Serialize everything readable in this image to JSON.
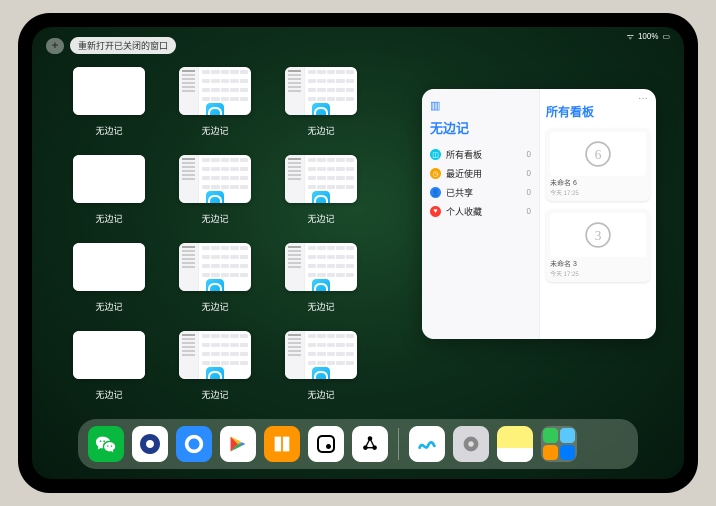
{
  "status": {
    "battery": "100%"
  },
  "topbar": {
    "plus": "+",
    "reopen_label": "重新打开已关闭的窗口"
  },
  "tile_label": "无边记",
  "tiles": [
    {
      "style": "blank"
    },
    {
      "style": "cal"
    },
    {
      "style": "cal"
    },
    {
      "style": "blank"
    },
    {
      "style": "cal"
    },
    {
      "style": "cal"
    },
    {
      "style": "blank"
    },
    {
      "style": "cal"
    },
    {
      "style": "cal"
    },
    {
      "style": "blank"
    },
    {
      "style": "cal"
    },
    {
      "style": "cal"
    }
  ],
  "popup": {
    "left_title": "无边记",
    "right_title": "所有看板",
    "more": "···",
    "categories": [
      {
        "label": "所有看板",
        "count": 0,
        "color": "#0ac8e8",
        "icon": "grid"
      },
      {
        "label": "最近使用",
        "count": 0,
        "color": "#f7a500",
        "icon": "clock"
      },
      {
        "label": "已共享",
        "count": 0,
        "color": "#2a82ff",
        "icon": "person"
      },
      {
        "label": "个人收藏",
        "count": 0,
        "color": "#ff3b30",
        "icon": "heart"
      }
    ],
    "boards": [
      {
        "name": "未命名 6",
        "time": "今天 17:25",
        "glyph": "6"
      },
      {
        "name": "未命名 3",
        "time": "今天 17:25",
        "glyph": "3"
      }
    ]
  },
  "dock": {
    "apps": [
      {
        "name": "wechat",
        "bg": "#09b83e"
      },
      {
        "name": "app-blue-o",
        "bg": "#ffffff"
      },
      {
        "name": "qq-browser",
        "bg": "#2a8cff"
      },
      {
        "name": "play",
        "bg": "#ffffff"
      },
      {
        "name": "books",
        "bg": "#ff9500"
      },
      {
        "name": "dot-box",
        "bg": "#ffffff"
      },
      {
        "name": "triple-dot",
        "bg": "#ffffff"
      }
    ],
    "recent": [
      {
        "name": "freeform",
        "bg": "#ffffff"
      },
      {
        "name": "settings",
        "bg": "#d7d7dc"
      },
      {
        "name": "notes",
        "bg": "#fff27a"
      }
    ]
  }
}
